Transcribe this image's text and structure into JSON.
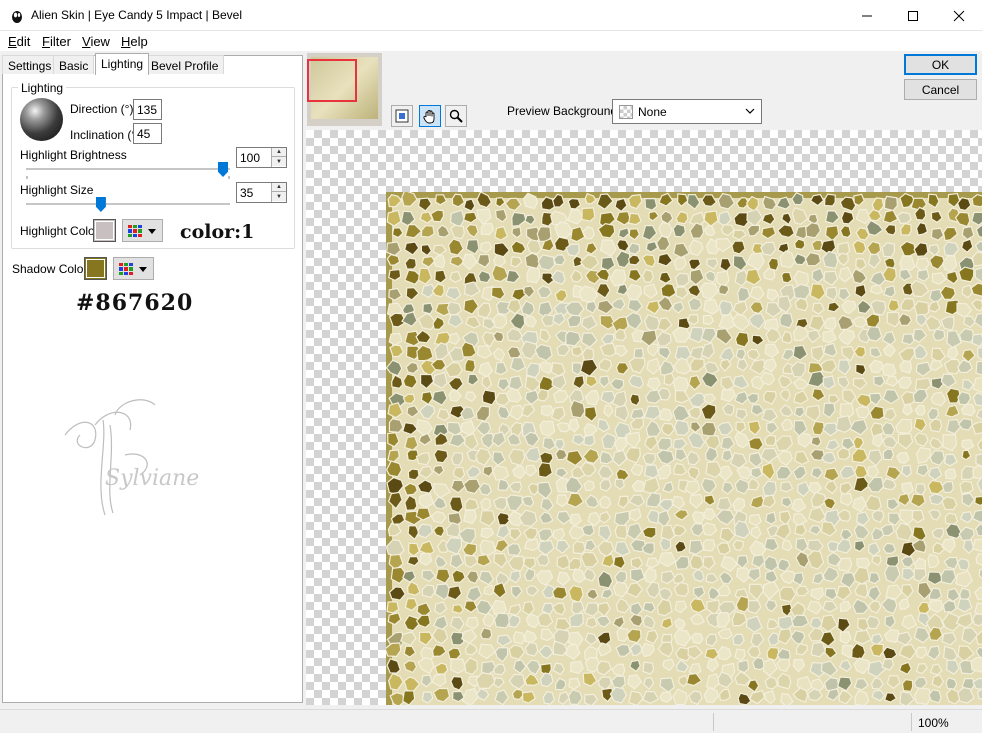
{
  "window": {
    "title": "Alien Skin | Eye Candy 5 Impact | Bevel",
    "controls": [
      "minimize-icon",
      "maximize-icon",
      "close-icon"
    ]
  },
  "menu": {
    "items": [
      {
        "label": "Edit",
        "accel": "E",
        "rest": "dit"
      },
      {
        "label": "Filter",
        "accel": "F",
        "rest": "ilter"
      },
      {
        "label": "View",
        "accel": "V",
        "rest": "iew"
      },
      {
        "label": "Help",
        "accel": "H",
        "rest": "elp"
      }
    ]
  },
  "tabs": [
    "Settings",
    "Basic",
    "Lighting",
    "Bevel Profile"
  ],
  "active_tab": "Lighting",
  "lighting": {
    "group_label": "Lighting",
    "direction_label": "Direction (°)",
    "direction_value": "135",
    "inclination_label": "Inclination (°)",
    "inclination_value": "45",
    "highlight_brightness_label": "Highlight Brightness",
    "highlight_brightness_value": "100",
    "highlight_brightness_level": 1.0,
    "highlight_size_label": "Highlight Size",
    "highlight_size_value": "35",
    "highlight_size_level": 0.35,
    "highlight_color_label": "Highlight Color",
    "highlight_color": "#c8c0c0",
    "highlight_note": "color:1"
  },
  "shadow": {
    "label": "Shadow Color",
    "color": "#867620",
    "note": "#867620"
  },
  "watermark": {
    "text": "Sylviane"
  },
  "preview": {
    "background_label": "Preview Background:",
    "background_value": "None",
    "tools": [
      "navigate-icon",
      "hand-icon",
      "zoom-icon"
    ],
    "active_tool": "hand-icon"
  },
  "buttons": {
    "ok": "OK",
    "cancel": "Cancel"
  },
  "status": {
    "zoom": "100%"
  },
  "colors": {
    "accent": "#0078d7",
    "thumb_frame": "#e8333c",
    "mosaic_base": "#e4dcb4",
    "mosaic_dark": "#867620"
  }
}
